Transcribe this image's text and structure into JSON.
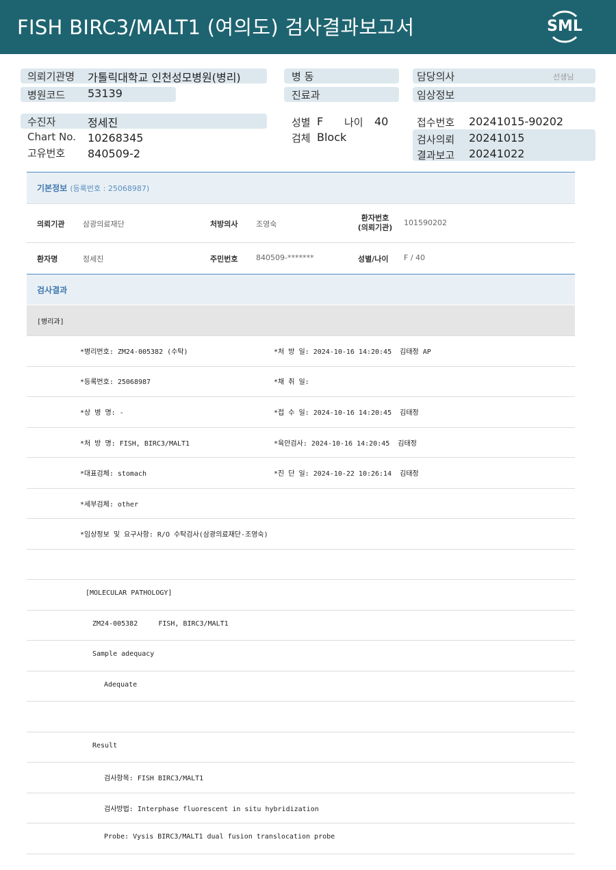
{
  "header": {
    "title": "FISH  BIRC3/MALT1  (여의도) 검사결과보고서",
    "logo": "SML"
  },
  "summary": {
    "request_org_label": "의뢰기관명",
    "request_org_value": "가톨릭대학교 인천성모병원(병리)",
    "hospital_code_label": "병원코드",
    "hospital_code_value": "53139",
    "ward_label": "병   동",
    "department_label": "진료과",
    "doctor_label": "담당의사",
    "doctor_suffix": "선생님",
    "clinical_info_label": "임상정보",
    "patient_label": "수진자",
    "patient_value": "정세진",
    "chart_label": "Chart No.",
    "chart_value": "10268345",
    "unique_label": "고유번호",
    "unique_value": "840509-2",
    "sex_label": "성별",
    "sex_value": "F",
    "age_label": "나이",
    "age_value": "40",
    "specimen_label": "검체",
    "specimen_value": "Block",
    "receipt_label": "접수번호",
    "receipt_value": "20241015-90202",
    "request_date_label": "검사의뢰",
    "request_date_value": "20241015",
    "report_date_label": "결과보고",
    "report_date_value": "20241022"
  },
  "basic_info": {
    "title": "기본정보",
    "reg_no": "(등록번호 : 25068987)",
    "rows": [
      {
        "l1": "의뢰기관",
        "v1": "삼광의료재단",
        "l2": "처방의사",
        "v2": "조영숙",
        "l3a": "환자번호",
        "l3b": "(의뢰기관)",
        "v3": "101590202"
      },
      {
        "l1": "환자명",
        "v1": "정세진",
        "l2": "주민번호",
        "v2": "840509-*******",
        "l3": "성별/나이",
        "v3": "F / 40"
      }
    ]
  },
  "results": {
    "title": "검사결과",
    "dept": "[병리과]",
    "lines": [
      {
        "left": "*병리번호: ZM24-005382 (수탁)",
        "right": "*처 방 일: 2024-10-16 14:20:45  김태정 AP"
      },
      {
        "left": "*등록번호: 25068987",
        "right": "*채 취 일:"
      },
      {
        "left": "*상 병 명: -",
        "right": "*접 수 일: 2024-10-16 14:20:45  김태정"
      },
      {
        "left": "*처 방 명: FISH, BIRC3/MALT1",
        "right": "*육안검사: 2024-10-16 14:20:45  김태정"
      },
      {
        "left": "*대표검체: stomach",
        "right": "*진 단 일: 2024-10-22 10:26:14  김태정"
      },
      {
        "left": "*세부검체: other",
        "right": ""
      },
      {
        "left": "*임상정보 및 요구사항: R/O 수탁검사(삼광의료재단-조영숙)",
        "right": ""
      }
    ],
    "body": [
      "",
      "[MOLECULAR PATHOLOGY]",
      "ZM24-005382     FISH, BIRC3/MALT1",
      "Sample adequacy",
      "Adequate",
      "",
      "Result",
      "검사항목: FISH BIRC3/MALT1",
      "검사방법: Interphase fluorescent in situ hybridization",
      "Probe: Vysis BIRC3/MALT1 dual fusion translocation probe"
    ]
  },
  "colors": {
    "banner": "#1e6470",
    "pill": "#dde8ee",
    "section_band": "#e9f0f5",
    "dept_band": "#e5e5e5",
    "accent_line": "#4a8ac4"
  }
}
